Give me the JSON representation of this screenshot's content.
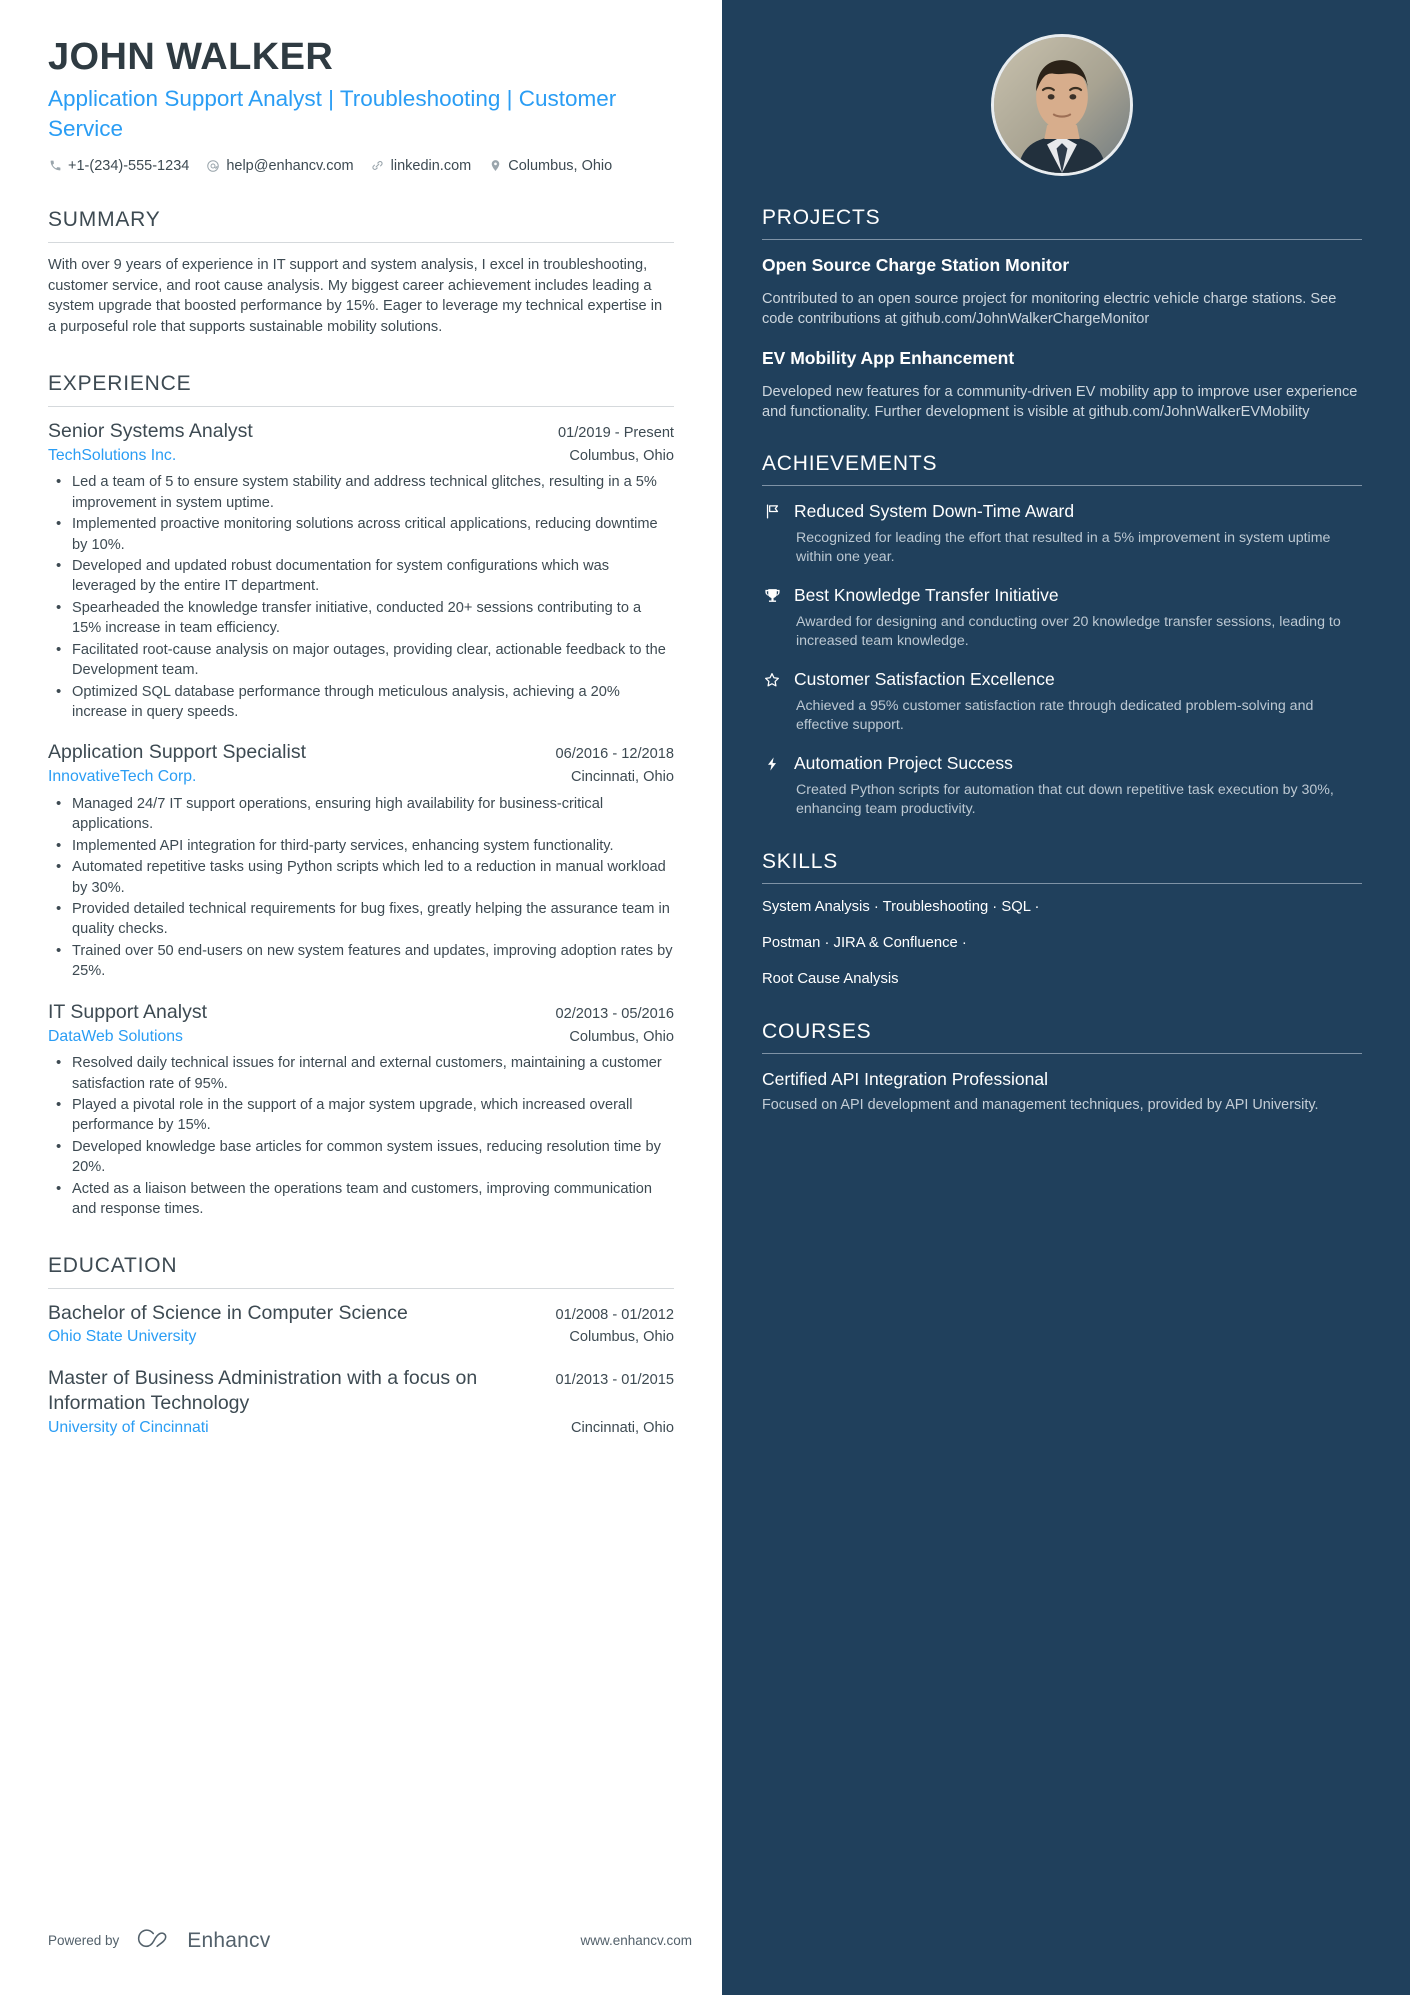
{
  "header": {
    "name": "JOHN WALKER",
    "headline": "Application Support Analyst | Troubleshooting | Customer Service",
    "contacts": [
      {
        "icon": "phone-icon",
        "text": "+1-(234)-555-1234"
      },
      {
        "icon": "email-icon",
        "text": "help@enhancv.com"
      },
      {
        "icon": "link-icon",
        "text": "linkedin.com"
      },
      {
        "icon": "location-icon",
        "text": "Columbus, Ohio"
      }
    ]
  },
  "summary": {
    "title": "SUMMARY",
    "text": "With over 9 years of experience in IT support and system analysis, I excel in troubleshooting, customer service, and root cause analysis. My biggest career achievement includes leading a system upgrade that boosted performance by 15%. Eager to leverage my technical expertise in a purposeful role that supports sustainable mobility solutions."
  },
  "experience": {
    "title": "EXPERIENCE",
    "entries": [
      {
        "role": "Senior Systems Analyst",
        "date": "01/2019 - Present",
        "company": "TechSolutions Inc.",
        "location": "Columbus, Ohio",
        "bullets": [
          "Led a team of 5 to ensure system stability and address technical glitches, resulting in a 5% improvement in system uptime.",
          "Implemented proactive monitoring solutions across critical applications, reducing downtime by 10%.",
          "Developed and updated robust documentation for system configurations which was leveraged by the entire IT department.",
          "Spearheaded the knowledge transfer initiative, conducted 20+ sessions contributing to a 15% increase in team efficiency.",
          "Facilitated root-cause analysis on major outages, providing clear, actionable feedback to the Development team.",
          "Optimized SQL database performance through meticulous analysis, achieving a 20% increase in query speeds."
        ]
      },
      {
        "role": "Application Support Specialist",
        "date": "06/2016 - 12/2018",
        "company": "InnovativeTech Corp.",
        "location": "Cincinnati, Ohio",
        "bullets": [
          "Managed 24/7 IT support operations, ensuring high availability for business-critical applications.",
          "Implemented API integration for third-party services, enhancing system functionality.",
          "Automated repetitive tasks using Python scripts which led to a reduction in manual workload by 30%.",
          "Provided detailed technical requirements for bug fixes, greatly helping the assurance team in quality checks.",
          "Trained over 50 end-users on new system features and updates, improving adoption rates by 25%."
        ]
      },
      {
        "role": "IT Support Analyst",
        "date": "02/2013 - 05/2016",
        "company": "DataWeb Solutions",
        "location": "Columbus, Ohio",
        "bullets": [
          "Resolved daily technical issues for internal and external customers, maintaining a customer satisfaction rate of 95%.",
          "Played a pivotal role in the support of a major system upgrade, which increased overall performance by 15%.",
          "Developed knowledge base articles for common system issues, reducing resolution time by 20%.",
          "Acted as a liaison between the operations team and customers, improving communication and response times."
        ]
      }
    ]
  },
  "education": {
    "title": "EDUCATION",
    "entries": [
      {
        "degree": "Bachelor of Science in Computer Science",
        "date": "01/2008 - 01/2012",
        "school": "Ohio State University",
        "location": "Columbus, Ohio"
      },
      {
        "degree": "Master of Business Administration with a focus on Information Technology",
        "date": "01/2013 - 01/2015",
        "school": "University of Cincinnati",
        "location": "Cincinnati, Ohio"
      }
    ]
  },
  "footer": {
    "powered_by": "Powered by",
    "brand": "Enhancv",
    "website": "www.enhancv.com"
  },
  "sidebar": {
    "projects": {
      "title": "PROJECTS",
      "items": [
        {
          "name": "Open Source Charge Station Monitor",
          "description": "Contributed to an open source project for monitoring electric vehicle charge stations. See code contributions at github.com/JohnWalkerChargeMonitor"
        },
        {
          "name": "EV Mobility App Enhancement",
          "description": "Developed new features for a community-driven EV mobility app to improve user experience and functionality. Further development is visible at github.com/JohnWalkerEVMobility"
        }
      ]
    },
    "achievements": {
      "title": "ACHIEVEMENTS",
      "items": [
        {
          "icon": "flag-icon",
          "title": "Reduced System Down-Time Award",
          "description": "Recognized for leading the effort that resulted in a 5% improvement in system uptime within one year."
        },
        {
          "icon": "trophy-icon",
          "title": "Best Knowledge Transfer Initiative",
          "description": "Awarded for designing and conducting over 20 knowledge transfer sessions, leading to increased team knowledge."
        },
        {
          "icon": "star-icon",
          "title": "Customer Satisfaction Excellence",
          "description": "Achieved a 95% customer satisfaction rate through dedicated problem-solving and effective support."
        },
        {
          "icon": "bolt-icon",
          "title": "Automation Project Success",
          "description": "Created Python scripts for automation that cut down repetitive task execution by 30%, enhancing team productivity."
        }
      ]
    },
    "skills": {
      "title": "SKILLS",
      "lines": [
        "System Analysis · Troubleshooting · SQL ·",
        "Postman · JIRA & Confluence ·",
        "Root Cause Analysis"
      ]
    },
    "courses": {
      "title": "COURSES",
      "items": [
        {
          "name": "Certified API Integration Professional",
          "description": "Focused on API development and management techniques, provided by API University."
        }
      ]
    }
  },
  "colors": {
    "accent_blue": "#2a9df4",
    "sidebar_bg": "#20405c",
    "text_dark": "#3d4a52"
  }
}
